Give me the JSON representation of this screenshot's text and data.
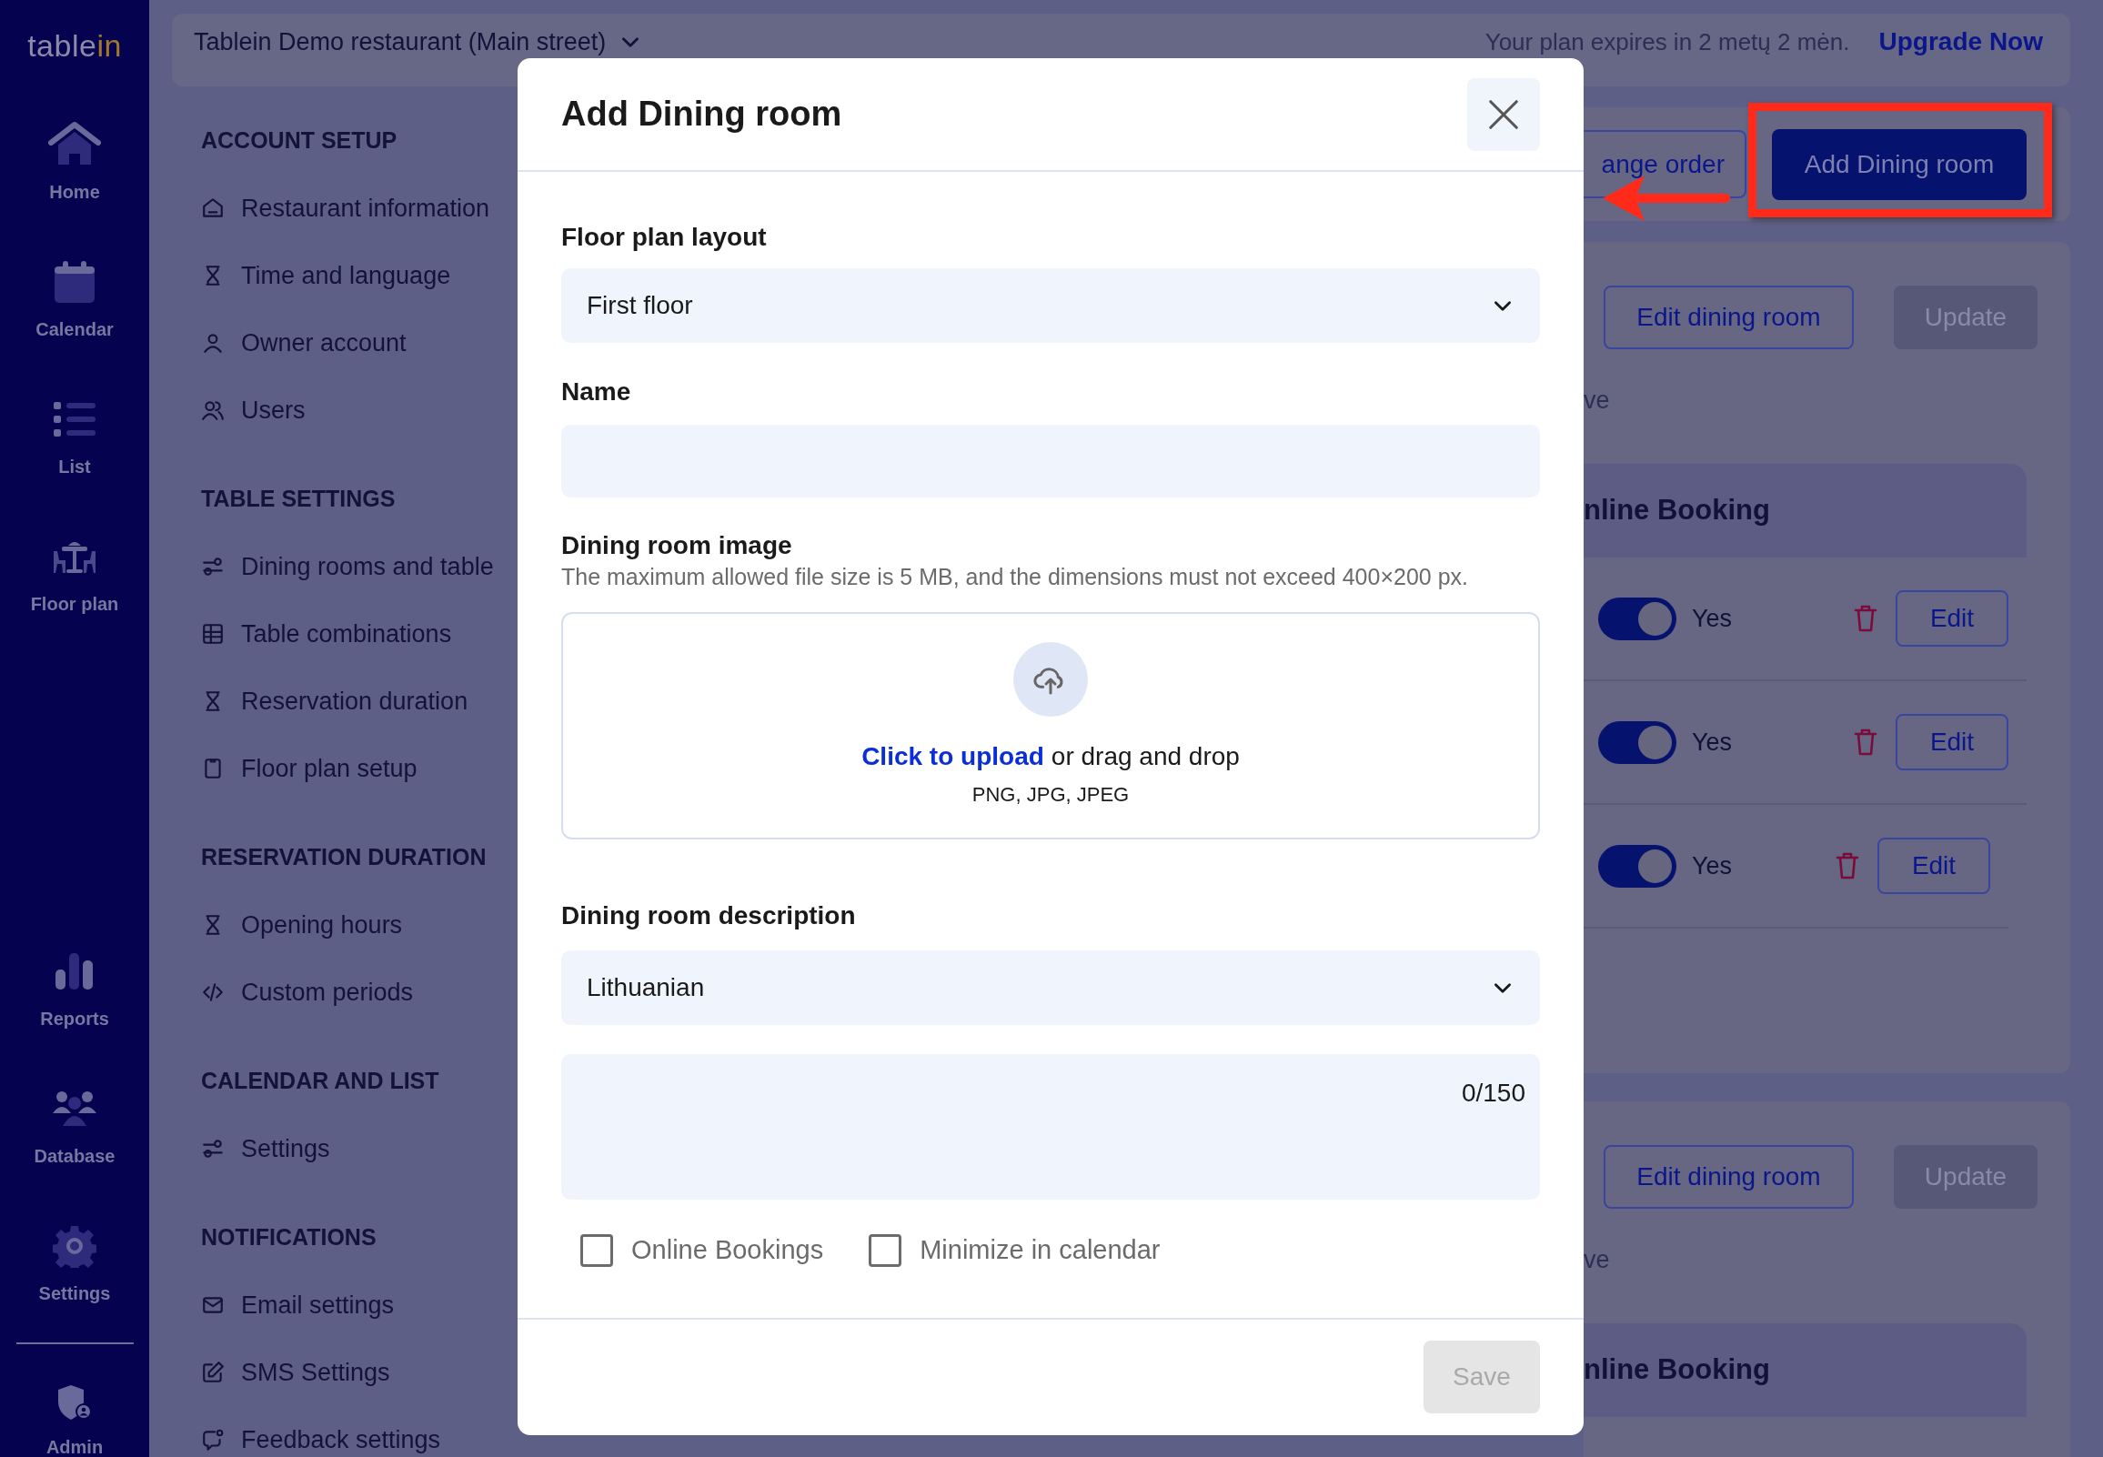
{
  "nav": {
    "logo": {
      "main": "table",
      "accent": "in"
    },
    "items": [
      {
        "label": "Home"
      },
      {
        "label": "Calendar"
      },
      {
        "label": "List"
      },
      {
        "label": "Floor plan"
      },
      {
        "label": "Reports"
      },
      {
        "label": "Database"
      },
      {
        "label": "Settings"
      },
      {
        "label": "Admin"
      }
    ]
  },
  "top_bar": {
    "restaurant": "Tablein Demo restaurant (Main street)",
    "plan_text": "Your plan expires in 2 metų 2 mėn.",
    "upgrade_link": "Upgrade Now"
  },
  "settings_menu": [
    {
      "heading": "ACCOUNT SETUP",
      "items": [
        {
          "label": "Restaurant information"
        },
        {
          "label": "Time and language"
        },
        {
          "label": "Owner account"
        },
        {
          "label": "Users"
        }
      ]
    },
    {
      "heading": "TABLE SETTINGS",
      "items": [
        {
          "label": "Dining rooms and table"
        },
        {
          "label": "Table combinations"
        },
        {
          "label": "Reservation duration"
        },
        {
          "label": "Floor plan setup"
        }
      ]
    },
    {
      "heading": "RESERVATION DURATION",
      "items": [
        {
          "label": "Opening hours"
        },
        {
          "label": "Custom periods"
        }
      ]
    },
    {
      "heading": "CALENDAR AND LIST",
      "items": [
        {
          "label": "Settings"
        }
      ]
    },
    {
      "heading": "NOTIFICATIONS",
      "items": [
        {
          "label": "Email settings"
        },
        {
          "label": "SMS Settings"
        },
        {
          "label": "Feedback settings"
        }
      ]
    }
  ],
  "toolbar": {
    "change_order_button": "ange order",
    "add_button": "Add Dining room"
  },
  "dining_rooms": [
    {
      "edit_button": "Edit dining room",
      "update_button": {
        "label": "Update",
        "disabled": true
      },
      "note": "ve",
      "header": "nline Booking",
      "rows": [
        {
          "on": true,
          "label": "Yes",
          "edit_button": "Edit"
        },
        {
          "on": true,
          "label": "Yes",
          "edit_button": "Edit"
        },
        {
          "on": true,
          "label": "Yes",
          "edit_button": "Edit"
        }
      ]
    },
    {
      "edit_button": "Edit dining room",
      "update_button": {
        "label": "Update",
        "disabled": true
      },
      "note": "ve",
      "header": "nline Booking"
    }
  ],
  "modal": {
    "title": "Add Dining room",
    "fields": [
      {
        "kind": "select",
        "label": "Floor plan layout",
        "value": "First floor"
      },
      {
        "kind": "text",
        "label": "Name"
      },
      {
        "kind": "upload",
        "label": "Dining room image",
        "hint": "The maximum allowed file size is 5 MB, and the dimensions must not exceed 400×200 px.",
        "link": "Click to upload",
        "text": "or drag and drop",
        "formats": "PNG, JPG, JPEG"
      },
      {
        "kind": "select",
        "label": "Dining room description",
        "value": "Lithuanian"
      },
      {
        "kind": "textarea",
        "counter": "0/150"
      }
    ],
    "checkboxes": [
      {
        "label": "Online Bookings",
        "checked": false
      },
      {
        "label": "Minimize in calendar",
        "checked": false
      }
    ],
    "save_button": {
      "label": "Save",
      "disabled": true
    }
  }
}
